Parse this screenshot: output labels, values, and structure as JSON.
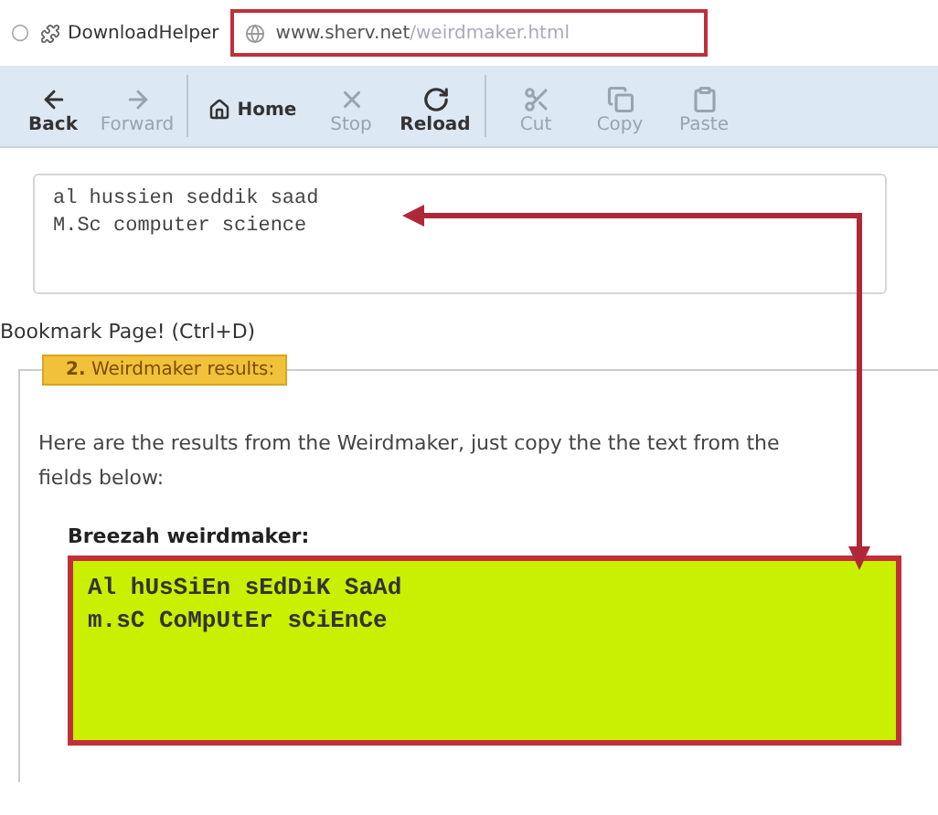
{
  "bookmarks_bar": {
    "bookmark": "DownloadHelper",
    "url_host": "www.sherv.net",
    "url_path": "/weirdmaker.html"
  },
  "toolbar": [
    {
      "label": "Back",
      "kind": "back",
      "disabled": false
    },
    {
      "label": "Forward",
      "kind": "forward",
      "disabled": true
    },
    {
      "label": "Home",
      "kind": "home",
      "disabled": false
    },
    {
      "label": "Stop",
      "kind": "stop",
      "disabled": true
    },
    {
      "label": "Reload",
      "kind": "reload",
      "disabled": false
    },
    {
      "label": "Cut",
      "kind": "cut",
      "disabled": true
    },
    {
      "label": "Copy",
      "kind": "copy",
      "disabled": true
    },
    {
      "label": "Paste",
      "kind": "paste",
      "disabled": true
    }
  ],
  "input_text": "al hussien seddik saad\nM.Sc computer science",
  "bookmark_hint": "Bookmark Page! (Ctrl+D)",
  "results": {
    "legend": "2. Weirdmaker results:",
    "intro": "Here are the results from the Weirdmaker, just copy the the text from the fields below:",
    "label": "Breezah weirdmaker:",
    "output_text": "Al hUsSiEn sEdDiK SaAd\nm.sC CoMpUtEr sCiEnCe"
  }
}
